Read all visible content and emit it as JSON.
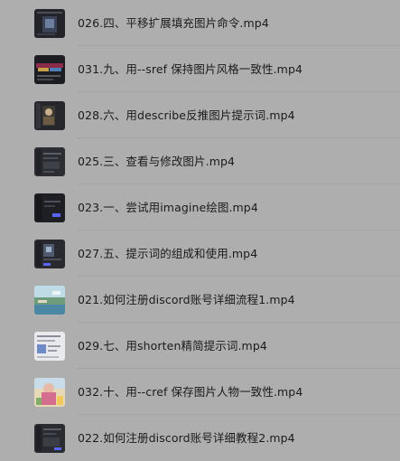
{
  "files": [
    {
      "name": "026.四、平移扩展填充图片命令.mp4",
      "thumbnail": "dark-screen-video-thumbnail"
    },
    {
      "name": "031.九、用--sref 保持图片风格一致性.mp4",
      "thumbnail": "colorful-screen-video-thumbnail"
    },
    {
      "name": "028.六、用describe反推图片提示词.mp4",
      "thumbnail": "portrait-screen-video-thumbnail"
    },
    {
      "name": "025.三、查看与修改图片.mp4",
      "thumbnail": "dark-app-video-thumbnail"
    },
    {
      "name": "023.一、尝试用imagine绘图.mp4",
      "thumbnail": "dark-chat-video-thumbnail"
    },
    {
      "name": "027.五、提示词的组成和使用.mp4",
      "thumbnail": "dark-app-video-thumbnail"
    },
    {
      "name": "021.如何注册discord账号详细流程1.mp4",
      "thumbnail": "landscape-video-thumbnail"
    },
    {
      "name": "029.七、用shorten精简提示词.mp4",
      "thumbnail": "light-page-video-thumbnail"
    },
    {
      "name": "032.十、用--cref 保存图片人物一致性.mp4",
      "thumbnail": "illustration-video-thumbnail"
    },
    {
      "name": "022.如何注册discord账号详细教程2.mp4",
      "thumbnail": "dark-app-video-thumbnail"
    }
  ]
}
